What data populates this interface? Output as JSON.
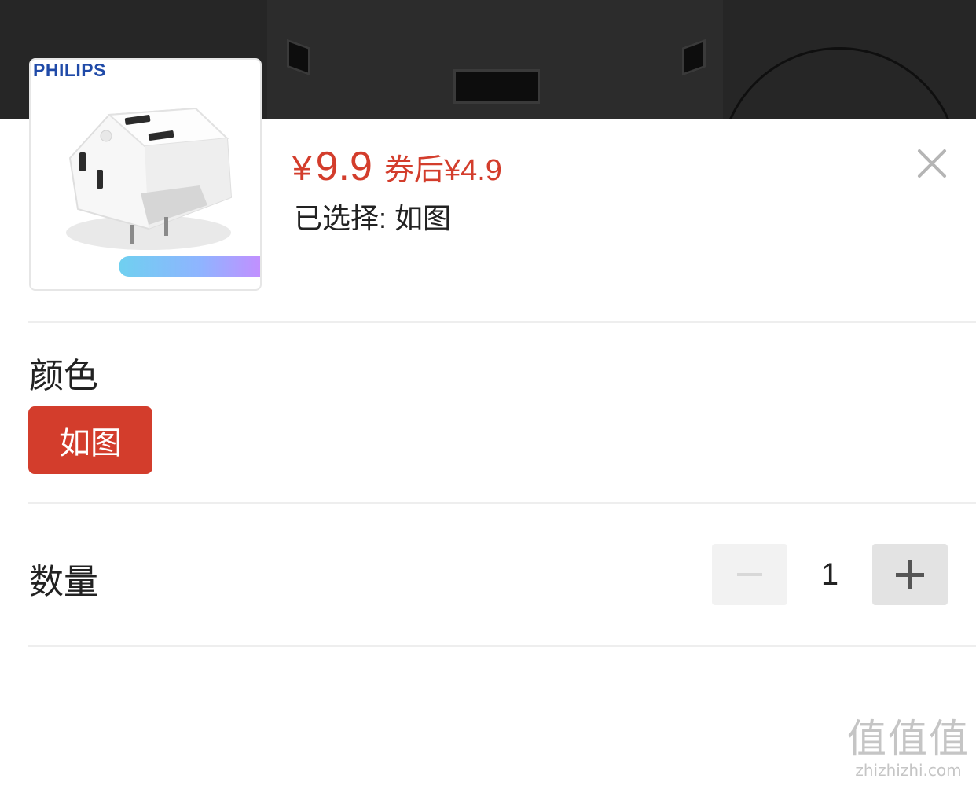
{
  "product": {
    "brand": "PHILIPS",
    "price_symbol": "¥",
    "price": "9.9",
    "coupon_label": "券后¥4.9",
    "selected_label": "已选择: 如图"
  },
  "color_section": {
    "title": "颜色",
    "options": [
      "如图"
    ],
    "selected": "如图"
  },
  "quantity_section": {
    "title": "数量",
    "value": "1",
    "minus_label": "−",
    "plus_label": "+"
  },
  "watermark": {
    "mark": "值值值",
    "site": "zhizhizhi.com"
  },
  "colors": {
    "accent": "#d33d2c",
    "backdrop": "#262626",
    "divider": "#eeeeee"
  }
}
